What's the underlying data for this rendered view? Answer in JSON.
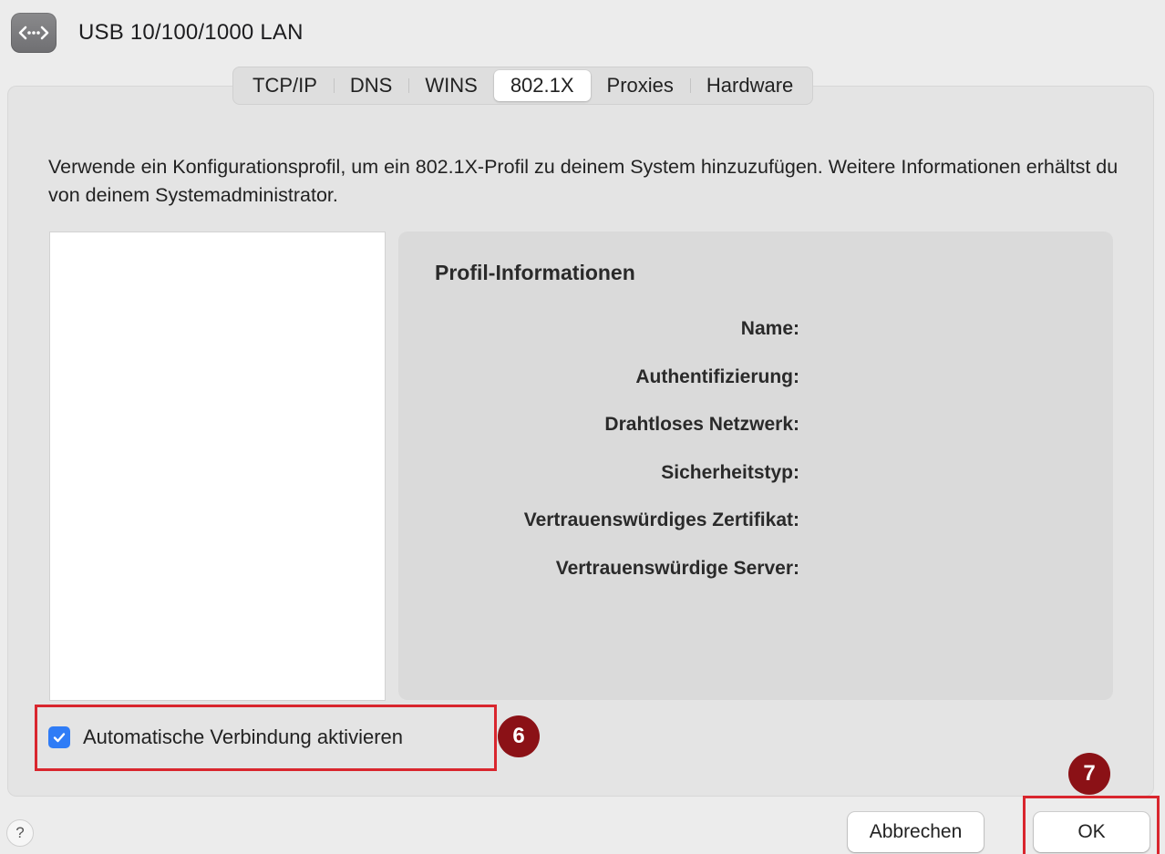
{
  "window": {
    "title": "USB 10/100/1000 LAN",
    "icon": "ethernet-icon"
  },
  "tabs": [
    {
      "label": "TCP/IP",
      "active": false
    },
    {
      "label": "DNS",
      "active": false
    },
    {
      "label": "WINS",
      "active": false
    },
    {
      "label": "802.1X",
      "active": true
    },
    {
      "label": "Proxies",
      "active": false
    },
    {
      "label": "Hardware",
      "active": false
    }
  ],
  "description": "Verwende ein Konfigurationsprofil, um ein 802.1X-Profil zu deinem System hinzuzufügen. Weitere Informationen erhältst du von deinem Systemadministrator.",
  "profile_info": {
    "title": "Profil-Informationen",
    "fields": [
      {
        "label": "Name:",
        "value": ""
      },
      {
        "label": "Authentifizierung:",
        "value": ""
      },
      {
        "label": "Drahtloses Netzwerk:",
        "value": ""
      },
      {
        "label": "Sicherheitstyp:",
        "value": ""
      },
      {
        "label": "Vertrauenswürdiges Zertifikat:",
        "value": ""
      },
      {
        "label": "Vertrauenswürdige Server:",
        "value": ""
      }
    ]
  },
  "auto_connect": {
    "label": "Automatische Verbindung aktivieren",
    "checked": true
  },
  "annotations": {
    "step_6": "6",
    "step_7": "7",
    "highlight_color": "#d9262e",
    "badge_color": "#8b1116"
  },
  "footer": {
    "help_label": "?",
    "cancel_label": "Abbrechen",
    "ok_label": "OK"
  },
  "colors": {
    "accent": "#2f7cf6"
  }
}
